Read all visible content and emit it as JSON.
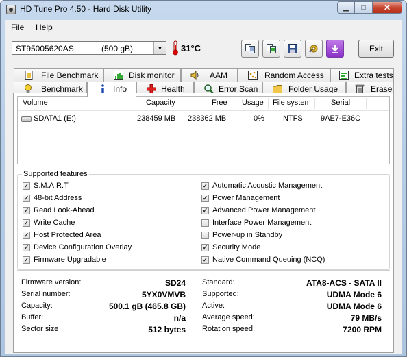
{
  "window": {
    "title": "HD Tune Pro 4.50 - Hard Disk Utility"
  },
  "menu": {
    "file": "File",
    "help": "Help"
  },
  "toolbar": {
    "drive_model": "ST95005620AS",
    "drive_size": "(500 gB)",
    "temperature": "31°C",
    "exit_label": "Exit"
  },
  "tabs_top": [
    {
      "label": "File Benchmark",
      "icon": "file-benchmark-icon"
    },
    {
      "label": "Disk monitor",
      "icon": "disk-monitor-icon"
    },
    {
      "label": "AAM",
      "icon": "speaker-icon"
    },
    {
      "label": "Random Access",
      "icon": "random-access-icon"
    },
    {
      "label": "Extra tests",
      "icon": "extra-tests-icon"
    }
  ],
  "tabs_bottom": [
    {
      "label": "Benchmark",
      "icon": "lightbulb-icon"
    },
    {
      "label": "Info",
      "icon": "info-icon",
      "active": true
    },
    {
      "label": "Health",
      "icon": "health-cross-icon"
    },
    {
      "label": "Error Scan",
      "icon": "magnifier-icon"
    },
    {
      "label": "Folder Usage",
      "icon": "folder-icon"
    },
    {
      "label": "Erase",
      "icon": "trash-icon"
    }
  ],
  "volume_table": {
    "columns": [
      "Volume",
      "Capacity",
      "Free",
      "Usage",
      "File system",
      "Serial"
    ],
    "rows": [
      {
        "volume": "SDATA1 (E:)",
        "capacity": "238459 MB",
        "free": "238362 MB",
        "usage": "0%",
        "fs": "NTFS",
        "serial": "9AE7-E36C"
      }
    ]
  },
  "features": {
    "title": "Supported features",
    "left": [
      {
        "label": "S.M.A.R.T",
        "checked": true
      },
      {
        "label": "48-bit Address",
        "checked": true
      },
      {
        "label": "Read Look-Ahead",
        "checked": true
      },
      {
        "label": "Write Cache",
        "checked": true
      },
      {
        "label": "Host Protected Area",
        "checked": true
      },
      {
        "label": "Device Configuration Overlay",
        "checked": true
      },
      {
        "label": "Firmware Upgradable",
        "checked": true
      }
    ],
    "right": [
      {
        "label": "Automatic Acoustic Management",
        "checked": true
      },
      {
        "label": "Power Management",
        "checked": true
      },
      {
        "label": "Advanced Power Management",
        "checked": true
      },
      {
        "label": "Interface Power Management",
        "checked": false
      },
      {
        "label": "Power-up in Standby",
        "checked": false
      },
      {
        "label": "Security Mode",
        "checked": true
      },
      {
        "label": "Native Command Queuing (NCQ)",
        "checked": true
      }
    ]
  },
  "info": {
    "left": [
      {
        "label": "Firmware version:",
        "value": "SD24"
      },
      {
        "label": "Serial number:",
        "value": "5YX0VMVB"
      },
      {
        "label": "Capacity:",
        "value": "500.1 gB (465.8 GB)"
      },
      {
        "label": "Buffer:",
        "value": "n/a"
      },
      {
        "label": "Sector size",
        "value": "512 bytes"
      }
    ],
    "right": [
      {
        "label": "Standard:",
        "value": "ATA8-ACS - SATA II"
      },
      {
        "label": "Supported:",
        "value": "UDMA Mode 6"
      },
      {
        "label": "Active:",
        "value": "UDMA Mode 6"
      },
      {
        "label": "Average speed:",
        "value": "79 MB/s"
      },
      {
        "label": "Rotation speed:",
        "value": "7200 RPM"
      }
    ]
  }
}
